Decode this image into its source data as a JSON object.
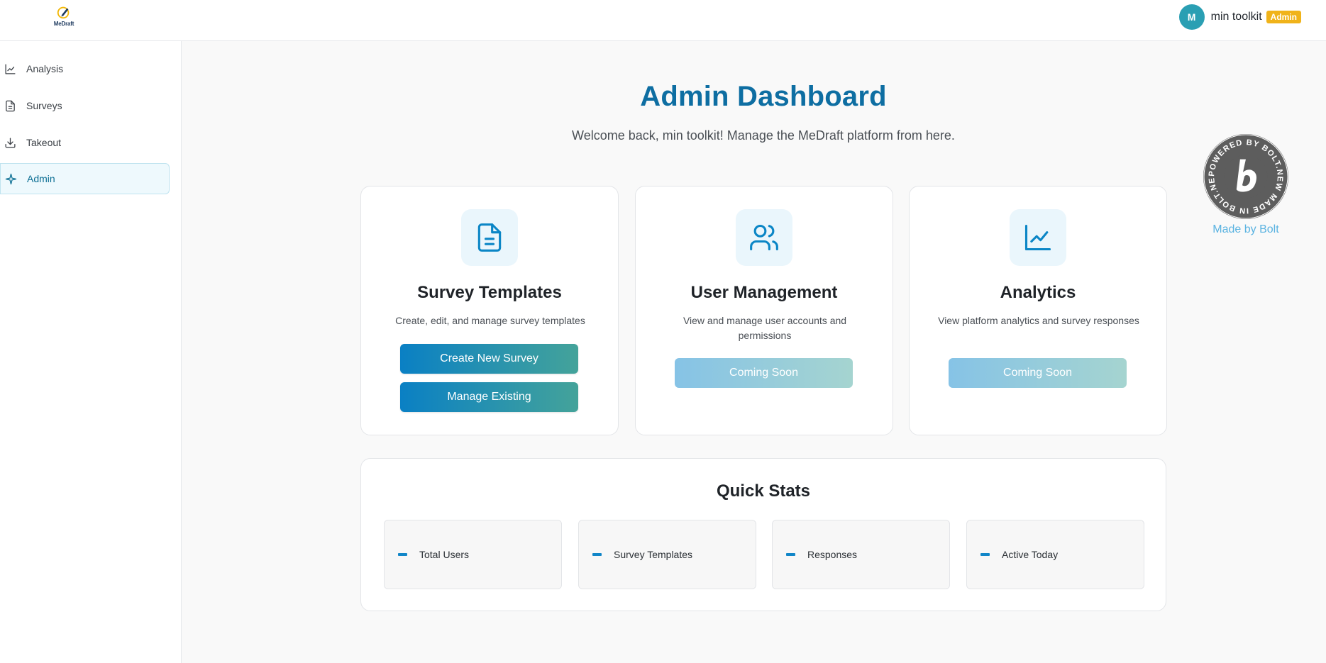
{
  "header": {
    "logo_text": "MeDraft",
    "user": {
      "initial": "M",
      "name": "min toolkit",
      "role": "Admin"
    }
  },
  "sidebar": {
    "items": [
      {
        "label": "Analysis",
        "icon": "chart-line-icon",
        "active": false
      },
      {
        "label": "Surveys",
        "icon": "document-icon",
        "active": false
      },
      {
        "label": "Takeout",
        "icon": "download-icon",
        "active": false
      },
      {
        "label": "Admin",
        "icon": "sparkle-icon",
        "active": true
      }
    ]
  },
  "main": {
    "title": "Admin Dashboard",
    "subtitle": "Welcome back, min toolkit! Manage the MeDraft platform from here.",
    "cards": [
      {
        "title": "Survey Templates",
        "description": "Create, edit, and manage survey templates",
        "icon": "document-icon",
        "buttons": [
          "Create New Survey",
          "Manage Existing"
        ]
      },
      {
        "title": "User Management",
        "description": "View and manage user accounts and permissions",
        "icon": "users-icon",
        "buttons": [
          "Coming Soon"
        ]
      },
      {
        "title": "Analytics",
        "description": "View platform analytics and survey responses",
        "icon": "chart-line-icon",
        "buttons": [
          "Coming Soon"
        ]
      }
    ],
    "quick_stats": {
      "title": "Quick Stats",
      "items": [
        {
          "value": "-",
          "label": "Total Users"
        },
        {
          "value": "-",
          "label": "Survey Templates"
        },
        {
          "value": "-",
          "label": "Responses"
        },
        {
          "value": "-",
          "label": "Active Today"
        }
      ]
    }
  },
  "bolt": {
    "badge_text": "POWERED BY BOLT.NEW MADE IN BOLT.NEW",
    "caption": "Made by Bolt"
  },
  "colors": {
    "accent": "#0e6ea2",
    "button_gradient_start": "#0a80c4",
    "button_gradient_end": "#44a39a",
    "admin_badge": "#f0b31a",
    "avatar": "#2a9fb3"
  }
}
